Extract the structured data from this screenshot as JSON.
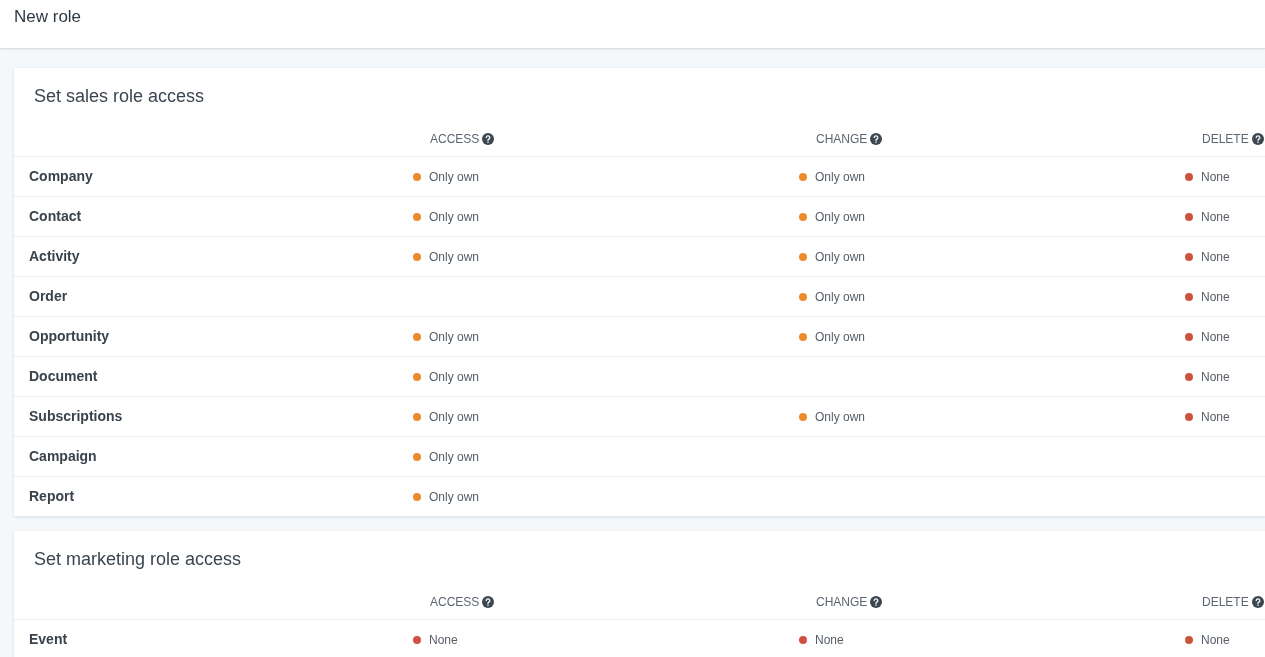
{
  "page": {
    "title": "New role"
  },
  "sections": [
    {
      "title": "Set sales role access",
      "columns": [
        "ACCESS",
        "CHANGE",
        "DELETE"
      ],
      "rows": [
        {
          "name": "Company",
          "access": {
            "value": "Only own",
            "color": "#ee8a2e"
          },
          "change": {
            "value": "Only own",
            "color": "#ee8a2e"
          },
          "delete": {
            "value": "None",
            "color": "#cc5340"
          }
        },
        {
          "name": "Contact",
          "access": {
            "value": "Only own",
            "color": "#ee8a2e"
          },
          "change": {
            "value": "Only own",
            "color": "#ee8a2e"
          },
          "delete": {
            "value": "None",
            "color": "#cc5340"
          }
        },
        {
          "name": "Activity",
          "access": {
            "value": "Only own",
            "color": "#ee8a2e"
          },
          "change": {
            "value": "Only own",
            "color": "#ee8a2e"
          },
          "delete": {
            "value": "None",
            "color": "#cc5340"
          }
        },
        {
          "name": "Order",
          "change": {
            "value": "Only own",
            "color": "#ee8a2e"
          },
          "delete": {
            "value": "None",
            "color": "#cc5340"
          }
        },
        {
          "name": "Opportunity",
          "access": {
            "value": "Only own",
            "color": "#ee8a2e"
          },
          "change": {
            "value": "Only own",
            "color": "#ee8a2e"
          },
          "delete": {
            "value": "None",
            "color": "#cc5340"
          }
        },
        {
          "name": "Document",
          "access": {
            "value": "Only own",
            "color": "#ee8a2e"
          },
          "delete": {
            "value": "None",
            "color": "#cc5340"
          }
        },
        {
          "name": "Subscriptions",
          "access": {
            "value": "Only own",
            "color": "#ee8a2e"
          },
          "change": {
            "value": "Only own",
            "color": "#ee8a2e"
          },
          "delete": {
            "value": "None",
            "color": "#cc5340"
          }
        },
        {
          "name": "Campaign",
          "access": {
            "value": "Only own",
            "color": "#ee8a2e"
          }
        },
        {
          "name": "Report",
          "access": {
            "value": "Only own",
            "color": "#ee8a2e"
          }
        }
      ]
    },
    {
      "title": "Set marketing role access",
      "columns": [
        "ACCESS",
        "CHANGE",
        "DELETE"
      ],
      "rows": [
        {
          "name": "Event",
          "access": {
            "value": "None",
            "color": "#cc5340"
          },
          "change": {
            "value": "None",
            "color": "#cc5340"
          },
          "delete": {
            "value": "None",
            "color": "#cc5340"
          }
        }
      ]
    }
  ]
}
